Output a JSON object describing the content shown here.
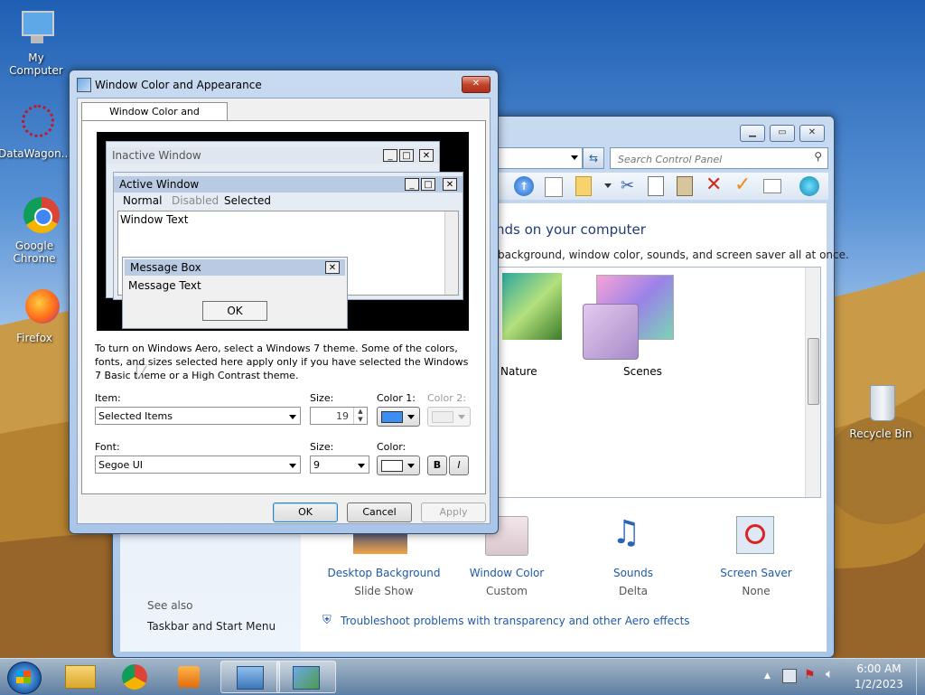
{
  "desktop": {
    "icons": [
      {
        "label": "My Computer"
      },
      {
        "label": "DataWagon..."
      },
      {
        "label": "Google Chrome"
      },
      {
        "label": "Firefox"
      },
      {
        "label": "Recycle Bin"
      }
    ]
  },
  "control_panel": {
    "search_placeholder": "Search Control Panel",
    "heading": "nds on your computer",
    "subheading": "background, window color, sounds, and screen saver all at once.",
    "themes": [
      {
        "label": "Nature"
      },
      {
        "label": "Scenes"
      }
    ],
    "bottom_items": [
      {
        "label": "Desktop Background",
        "sub": "Slide Show"
      },
      {
        "label": "Window Color",
        "sub": "Custom"
      },
      {
        "label": "Sounds",
        "sub": "Delta"
      },
      {
        "label": "Screen Saver",
        "sub": "None"
      }
    ],
    "see_also": "See also",
    "taskbar_link": "Taskbar and Start Menu",
    "troubleshoot": "Troubleshoot problems with transparency and other Aero effects"
  },
  "dialog": {
    "title": "Window Color and Appearance",
    "tab": "Window Color and Appearance",
    "preview": {
      "inactive_title": "Inactive Window",
      "active_title": "Active Window",
      "menu": [
        "Normal",
        "Disabled",
        "Selected"
      ],
      "window_text": "Window Text",
      "msgbox_title": "Message Box",
      "msgbox_text": "Message Text",
      "msgbox_ok": "OK"
    },
    "description": "To turn on Windows Aero, select a Windows 7 theme.  Some of the colors, fonts, and sizes selected here apply only if you have selected the Windows 7 Basic theme or a High Contrast theme.",
    "item_label": "Item:",
    "item_value": "Selected Items",
    "size_label": "Size:",
    "size_value": "19",
    "color1_label": "Color 1:",
    "color1_hex": "#3c8ef0",
    "color2_label": "Color 2:",
    "font_label": "Font:",
    "font_value": "Segoe UI",
    "font_size_label": "Size:",
    "font_size_value": "9",
    "font_color_label": "Color:",
    "font_color_hex": "#ffffff",
    "bold": "B",
    "italic": "I",
    "ok": "OK",
    "cancel": "Cancel",
    "apply": "Apply"
  },
  "taskbar": {
    "time": "6:00 AM",
    "date": "1/2/2023"
  }
}
